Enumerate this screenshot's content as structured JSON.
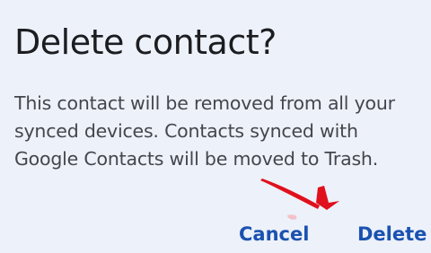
{
  "dialog": {
    "title": "Delete contact?",
    "body_lines": [
      "This contact will be removed from all your",
      "synced devices. Contacts synced with",
      "Google Contacts will be moved to Trash."
    ],
    "cancel_label": "Cancel",
    "delete_label": "Delete"
  },
  "annotation": {
    "type": "arrow",
    "color": "#e0101c",
    "points_to": "delete-button"
  },
  "colors": {
    "background": "#edf1f9",
    "title_text": "#1c1d21",
    "body_text": "#44464d",
    "accent": "#1a52b0"
  }
}
